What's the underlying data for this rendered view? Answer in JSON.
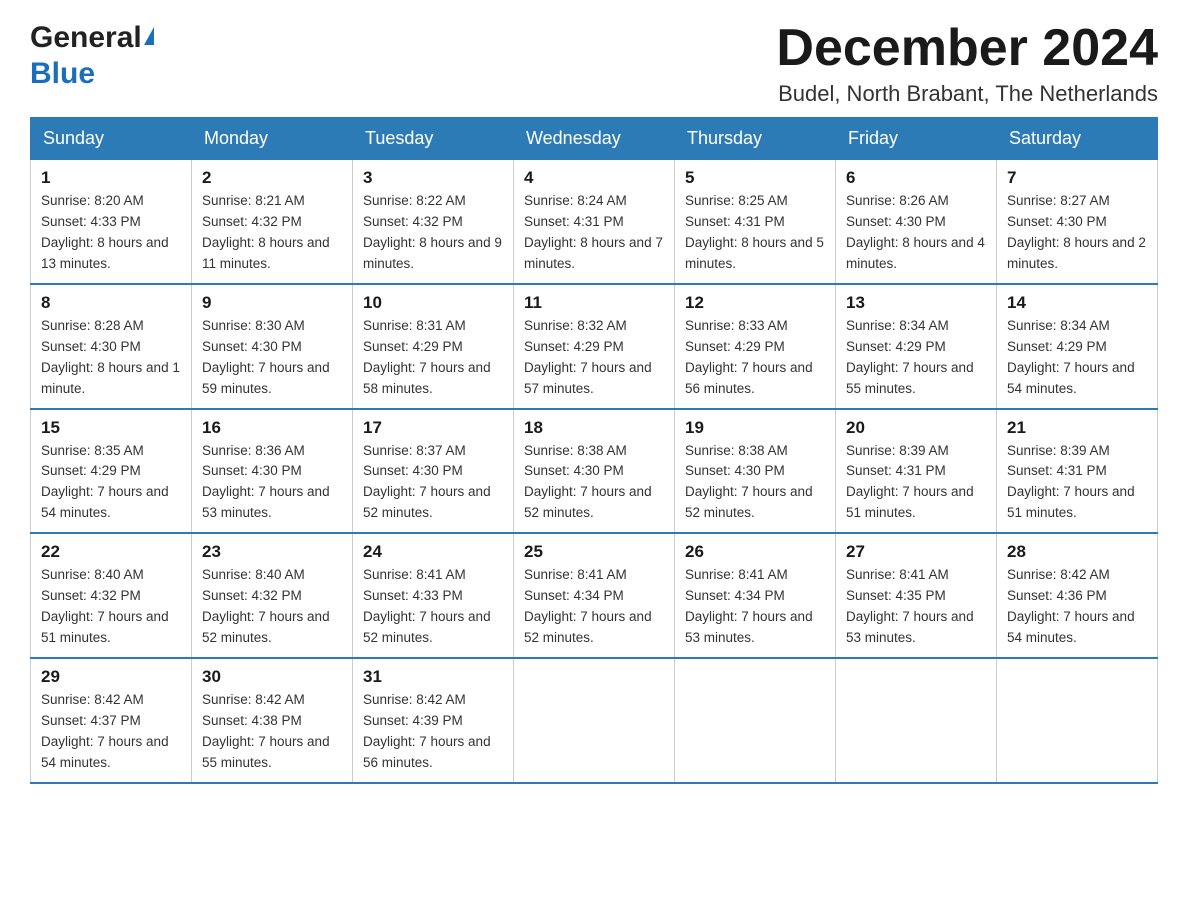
{
  "header": {
    "logo_general": "General",
    "logo_blue": "Blue",
    "month_title": "December 2024",
    "location": "Budel, North Brabant, The Netherlands"
  },
  "days_of_week": [
    "Sunday",
    "Monday",
    "Tuesday",
    "Wednesday",
    "Thursday",
    "Friday",
    "Saturday"
  ],
  "weeks": [
    [
      {
        "day": "1",
        "sunrise": "Sunrise: 8:20 AM",
        "sunset": "Sunset: 4:33 PM",
        "daylight": "Daylight: 8 hours and 13 minutes."
      },
      {
        "day": "2",
        "sunrise": "Sunrise: 8:21 AM",
        "sunset": "Sunset: 4:32 PM",
        "daylight": "Daylight: 8 hours and 11 minutes."
      },
      {
        "day": "3",
        "sunrise": "Sunrise: 8:22 AM",
        "sunset": "Sunset: 4:32 PM",
        "daylight": "Daylight: 8 hours and 9 minutes."
      },
      {
        "day": "4",
        "sunrise": "Sunrise: 8:24 AM",
        "sunset": "Sunset: 4:31 PM",
        "daylight": "Daylight: 8 hours and 7 minutes."
      },
      {
        "day": "5",
        "sunrise": "Sunrise: 8:25 AM",
        "sunset": "Sunset: 4:31 PM",
        "daylight": "Daylight: 8 hours and 5 minutes."
      },
      {
        "day": "6",
        "sunrise": "Sunrise: 8:26 AM",
        "sunset": "Sunset: 4:30 PM",
        "daylight": "Daylight: 8 hours and 4 minutes."
      },
      {
        "day": "7",
        "sunrise": "Sunrise: 8:27 AM",
        "sunset": "Sunset: 4:30 PM",
        "daylight": "Daylight: 8 hours and 2 minutes."
      }
    ],
    [
      {
        "day": "8",
        "sunrise": "Sunrise: 8:28 AM",
        "sunset": "Sunset: 4:30 PM",
        "daylight": "Daylight: 8 hours and 1 minute."
      },
      {
        "day": "9",
        "sunrise": "Sunrise: 8:30 AM",
        "sunset": "Sunset: 4:30 PM",
        "daylight": "Daylight: 7 hours and 59 minutes."
      },
      {
        "day": "10",
        "sunrise": "Sunrise: 8:31 AM",
        "sunset": "Sunset: 4:29 PM",
        "daylight": "Daylight: 7 hours and 58 minutes."
      },
      {
        "day": "11",
        "sunrise": "Sunrise: 8:32 AM",
        "sunset": "Sunset: 4:29 PM",
        "daylight": "Daylight: 7 hours and 57 minutes."
      },
      {
        "day": "12",
        "sunrise": "Sunrise: 8:33 AM",
        "sunset": "Sunset: 4:29 PM",
        "daylight": "Daylight: 7 hours and 56 minutes."
      },
      {
        "day": "13",
        "sunrise": "Sunrise: 8:34 AM",
        "sunset": "Sunset: 4:29 PM",
        "daylight": "Daylight: 7 hours and 55 minutes."
      },
      {
        "day": "14",
        "sunrise": "Sunrise: 8:34 AM",
        "sunset": "Sunset: 4:29 PM",
        "daylight": "Daylight: 7 hours and 54 minutes."
      }
    ],
    [
      {
        "day": "15",
        "sunrise": "Sunrise: 8:35 AM",
        "sunset": "Sunset: 4:29 PM",
        "daylight": "Daylight: 7 hours and 54 minutes."
      },
      {
        "day": "16",
        "sunrise": "Sunrise: 8:36 AM",
        "sunset": "Sunset: 4:30 PM",
        "daylight": "Daylight: 7 hours and 53 minutes."
      },
      {
        "day": "17",
        "sunrise": "Sunrise: 8:37 AM",
        "sunset": "Sunset: 4:30 PM",
        "daylight": "Daylight: 7 hours and 52 minutes."
      },
      {
        "day": "18",
        "sunrise": "Sunrise: 8:38 AM",
        "sunset": "Sunset: 4:30 PM",
        "daylight": "Daylight: 7 hours and 52 minutes."
      },
      {
        "day": "19",
        "sunrise": "Sunrise: 8:38 AM",
        "sunset": "Sunset: 4:30 PM",
        "daylight": "Daylight: 7 hours and 52 minutes."
      },
      {
        "day": "20",
        "sunrise": "Sunrise: 8:39 AM",
        "sunset": "Sunset: 4:31 PM",
        "daylight": "Daylight: 7 hours and 51 minutes."
      },
      {
        "day": "21",
        "sunrise": "Sunrise: 8:39 AM",
        "sunset": "Sunset: 4:31 PM",
        "daylight": "Daylight: 7 hours and 51 minutes."
      }
    ],
    [
      {
        "day": "22",
        "sunrise": "Sunrise: 8:40 AM",
        "sunset": "Sunset: 4:32 PM",
        "daylight": "Daylight: 7 hours and 51 minutes."
      },
      {
        "day": "23",
        "sunrise": "Sunrise: 8:40 AM",
        "sunset": "Sunset: 4:32 PM",
        "daylight": "Daylight: 7 hours and 52 minutes."
      },
      {
        "day": "24",
        "sunrise": "Sunrise: 8:41 AM",
        "sunset": "Sunset: 4:33 PM",
        "daylight": "Daylight: 7 hours and 52 minutes."
      },
      {
        "day": "25",
        "sunrise": "Sunrise: 8:41 AM",
        "sunset": "Sunset: 4:34 PM",
        "daylight": "Daylight: 7 hours and 52 minutes."
      },
      {
        "day": "26",
        "sunrise": "Sunrise: 8:41 AM",
        "sunset": "Sunset: 4:34 PM",
        "daylight": "Daylight: 7 hours and 53 minutes."
      },
      {
        "day": "27",
        "sunrise": "Sunrise: 8:41 AM",
        "sunset": "Sunset: 4:35 PM",
        "daylight": "Daylight: 7 hours and 53 minutes."
      },
      {
        "day": "28",
        "sunrise": "Sunrise: 8:42 AM",
        "sunset": "Sunset: 4:36 PM",
        "daylight": "Daylight: 7 hours and 54 minutes."
      }
    ],
    [
      {
        "day": "29",
        "sunrise": "Sunrise: 8:42 AM",
        "sunset": "Sunset: 4:37 PM",
        "daylight": "Daylight: 7 hours and 54 minutes."
      },
      {
        "day": "30",
        "sunrise": "Sunrise: 8:42 AM",
        "sunset": "Sunset: 4:38 PM",
        "daylight": "Daylight: 7 hours and 55 minutes."
      },
      {
        "day": "31",
        "sunrise": "Sunrise: 8:42 AM",
        "sunset": "Sunset: 4:39 PM",
        "daylight": "Daylight: 7 hours and 56 minutes."
      },
      null,
      null,
      null,
      null
    ]
  ]
}
